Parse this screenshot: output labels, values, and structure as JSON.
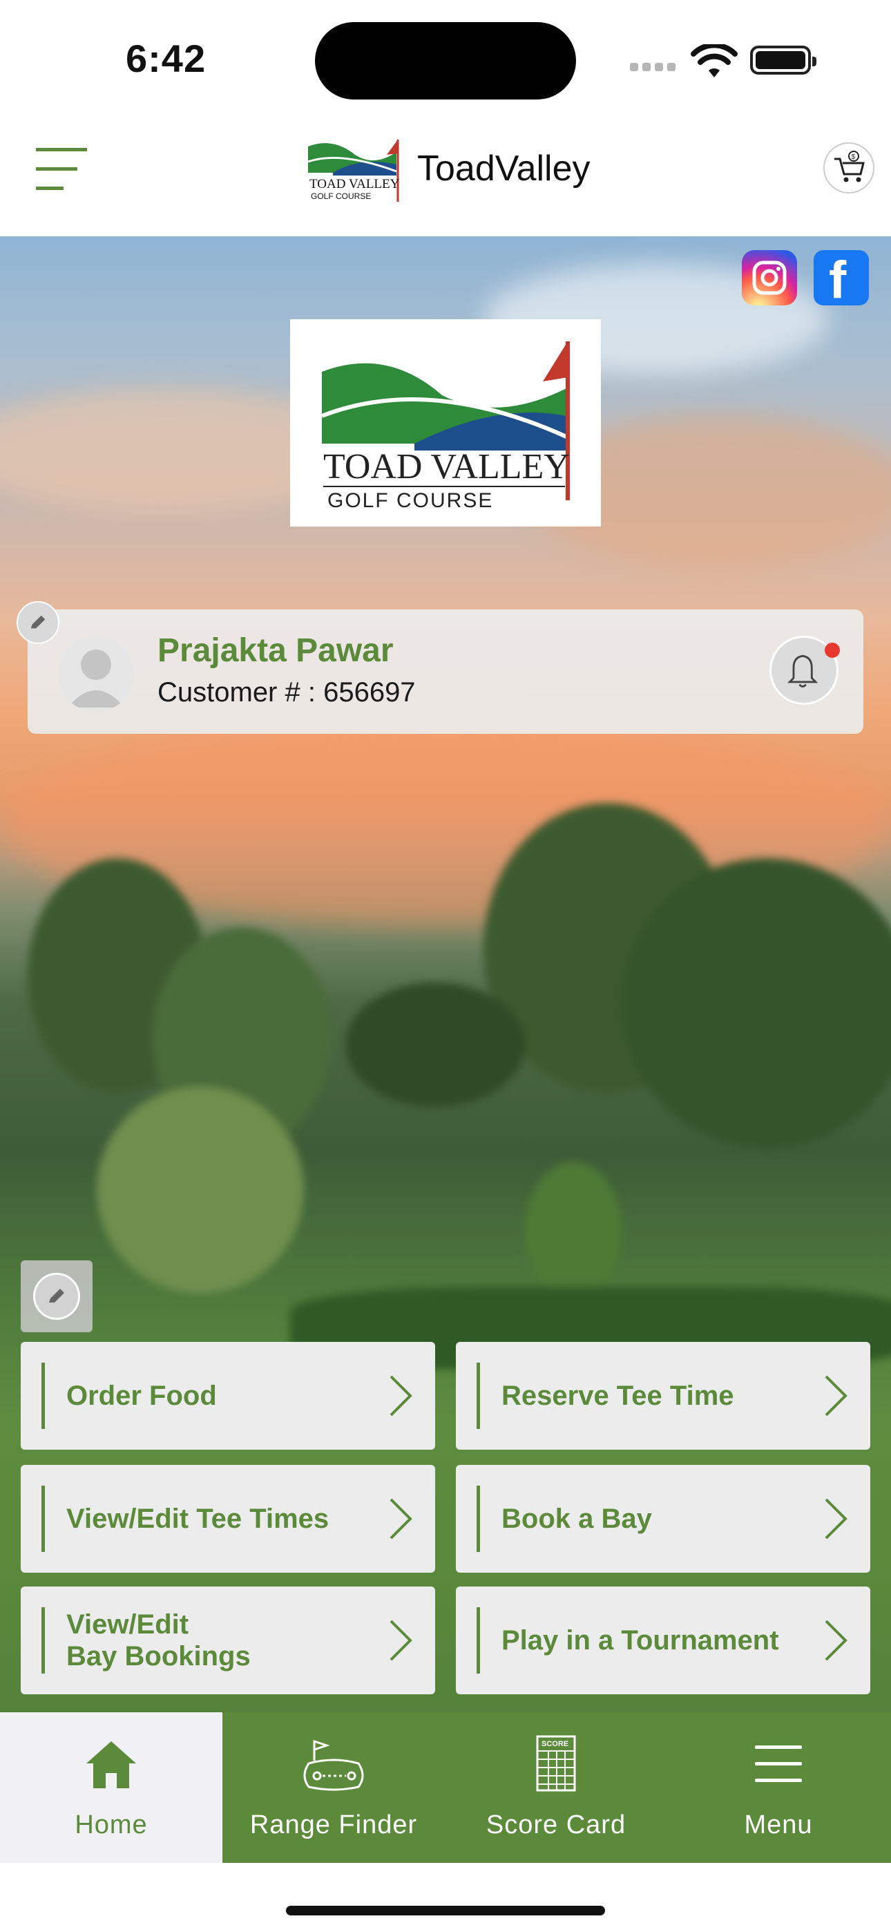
{
  "status_bar": {
    "time": "6:42"
  },
  "header": {
    "title": "ToadValley"
  },
  "logo": {
    "line1": "TOAD VALLEY",
    "line2": "GOLF COURSE"
  },
  "social": {
    "instagram": "instagram-icon",
    "facebook": "facebook-icon"
  },
  "profile": {
    "name": "Prajakta Pawar",
    "customer_line": "Customer # : 656697",
    "has_notification": true
  },
  "actions": [
    {
      "label": "Order Food"
    },
    {
      "label": "Reserve Tee Time"
    },
    {
      "label": "View/Edit Tee Times"
    },
    {
      "label": "Book a Bay"
    },
    {
      "label": "View/Edit\nBay Bookings"
    },
    {
      "label": "Play in a Tournament"
    }
  ],
  "tabs": [
    {
      "label": "Home",
      "icon": "home-icon",
      "active": true
    },
    {
      "label": "Range Finder",
      "icon": "range-finder-icon"
    },
    {
      "label": "Score Card",
      "icon": "score-card-icon",
      "icon_text": "SCORE"
    },
    {
      "label": "Menu",
      "icon": "menu-icon"
    }
  ],
  "colors": {
    "brand_green": "#5b8a3a",
    "notification": "#e8392e",
    "facebook": "#1877f2"
  }
}
